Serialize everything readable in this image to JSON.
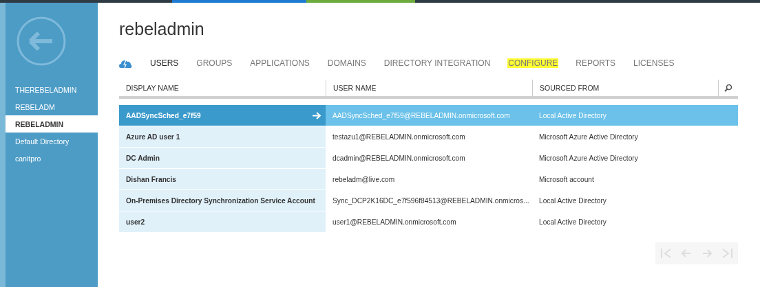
{
  "sidebar": {
    "items": [
      {
        "label": "THEREBELADMIN",
        "selected": false
      },
      {
        "label": "REBELADM",
        "selected": false
      },
      {
        "label": "REBELADMIN",
        "selected": true
      },
      {
        "label": "Default Directory",
        "selected": false
      },
      {
        "label": "canitpro",
        "selected": false
      }
    ]
  },
  "title": "rebeladmin",
  "tabs": [
    {
      "label": "USERS",
      "selected": true,
      "highlighted": false
    },
    {
      "label": "GROUPS",
      "selected": false,
      "highlighted": false
    },
    {
      "label": "APPLICATIONS",
      "selected": false,
      "highlighted": false
    },
    {
      "label": "DOMAINS",
      "selected": false,
      "highlighted": false
    },
    {
      "label": "DIRECTORY INTEGRATION",
      "selected": false,
      "highlighted": false
    },
    {
      "label": "CONFIGURE",
      "selected": false,
      "highlighted": true
    },
    {
      "label": "REPORTS",
      "selected": false,
      "highlighted": false
    },
    {
      "label": "LICENSES",
      "selected": false,
      "highlighted": false
    }
  ],
  "table": {
    "columns": [
      "DISPLAY NAME",
      "USER NAME",
      "SOURCED FROM"
    ],
    "rows": [
      {
        "cells": [
          "AADSyncSched_e7f59",
          "AADSyncSched_e7f59@REBELADMIN.onmicrosoft.com",
          "Local Active Directory"
        ],
        "selected": true
      },
      {
        "cells": [
          "Azure AD user 1",
          "testazu1@REBELADMIN.onmicrosoft.com",
          "Microsoft Azure Active Directory"
        ],
        "selected": false
      },
      {
        "cells": [
          "DC Admin",
          "dcadmin@REBELADMIN.onmicrosoft.com",
          "Microsoft Azure Active Directory"
        ],
        "selected": false
      },
      {
        "cells": [
          "Dishan Francis",
          "rebeladm@live.com",
          "Microsoft account"
        ],
        "selected": false
      },
      {
        "cells": [
          "On-Premises Directory Synchronization Service Account",
          "Sync_DCP2K16DC_e7f596f84513@REBELADMIN.onmicros...",
          "Local Active Directory"
        ],
        "selected": false
      },
      {
        "cells": [
          "user2",
          "user1@REBELADMIN.onmicrosoft.com",
          "Local Active Directory"
        ],
        "selected": false
      }
    ]
  }
}
